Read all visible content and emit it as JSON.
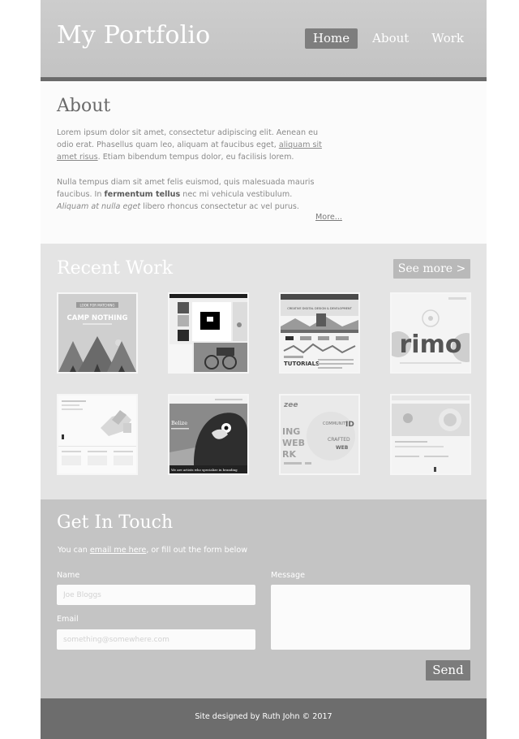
{
  "header": {
    "site_title": "My Portfolio",
    "nav": [
      "Home",
      "About",
      "Work"
    ],
    "active_nav": "Home"
  },
  "about": {
    "heading": "About",
    "p1": {
      "a": "Lorem ipsum dolor sit amet, consectetur adipiscing elit. Aenean eu odio erat. Phasellus quam leo, aliquam at faucibus eget, ",
      "link": "aliquam sit amet risus",
      "b": ". Etiam bibendum tempus dolor, eu facilisis lorem."
    },
    "p2": {
      "a": "Nulla tempus diam sit amet felis euismod, quis malesuada mauris faucibus. In ",
      "bold": "fermentum tellus",
      "b": " nec mi vehicula vestibulum. ",
      "italic": "Aliquam at nulla eget",
      "c": " libero rhoncus consectetur ac vel purus."
    },
    "more_link": "More..."
  },
  "work": {
    "heading": "Recent Work",
    "see_more": "See more >",
    "thumbs": [
      {
        "title": "LOOK FOR MATCHING",
        "headline": "CAMP NOTHING"
      },
      {
        "title": ""
      },
      {
        "title": "CREATIVE DIGITAL DESIGN & DEVELOPMENT",
        "headline": "TUTORIALS"
      },
      {
        "title": "rimo"
      },
      {
        "title": ""
      },
      {
        "title": "Belize",
        "tagline": "We are artists who specialize in branding"
      },
      {
        "title": "ING WEB RK",
        "tagline": "COMMUNITY ID CRAFTED WEB"
      },
      {
        "title": ""
      }
    ]
  },
  "contact": {
    "heading": "Get In Touch",
    "intro_before": "You can ",
    "intro_link": "email me here",
    "intro_after": ", or fill out the form below",
    "name_label": "Name",
    "name_placeholder": "Joe Bloggs",
    "email_label": "Email",
    "email_placeholder": "something@somewhere.com",
    "message_label": "Message",
    "send_label": "Send"
  },
  "footer": {
    "credit": "Site designed by Ruth John © 2017"
  }
}
